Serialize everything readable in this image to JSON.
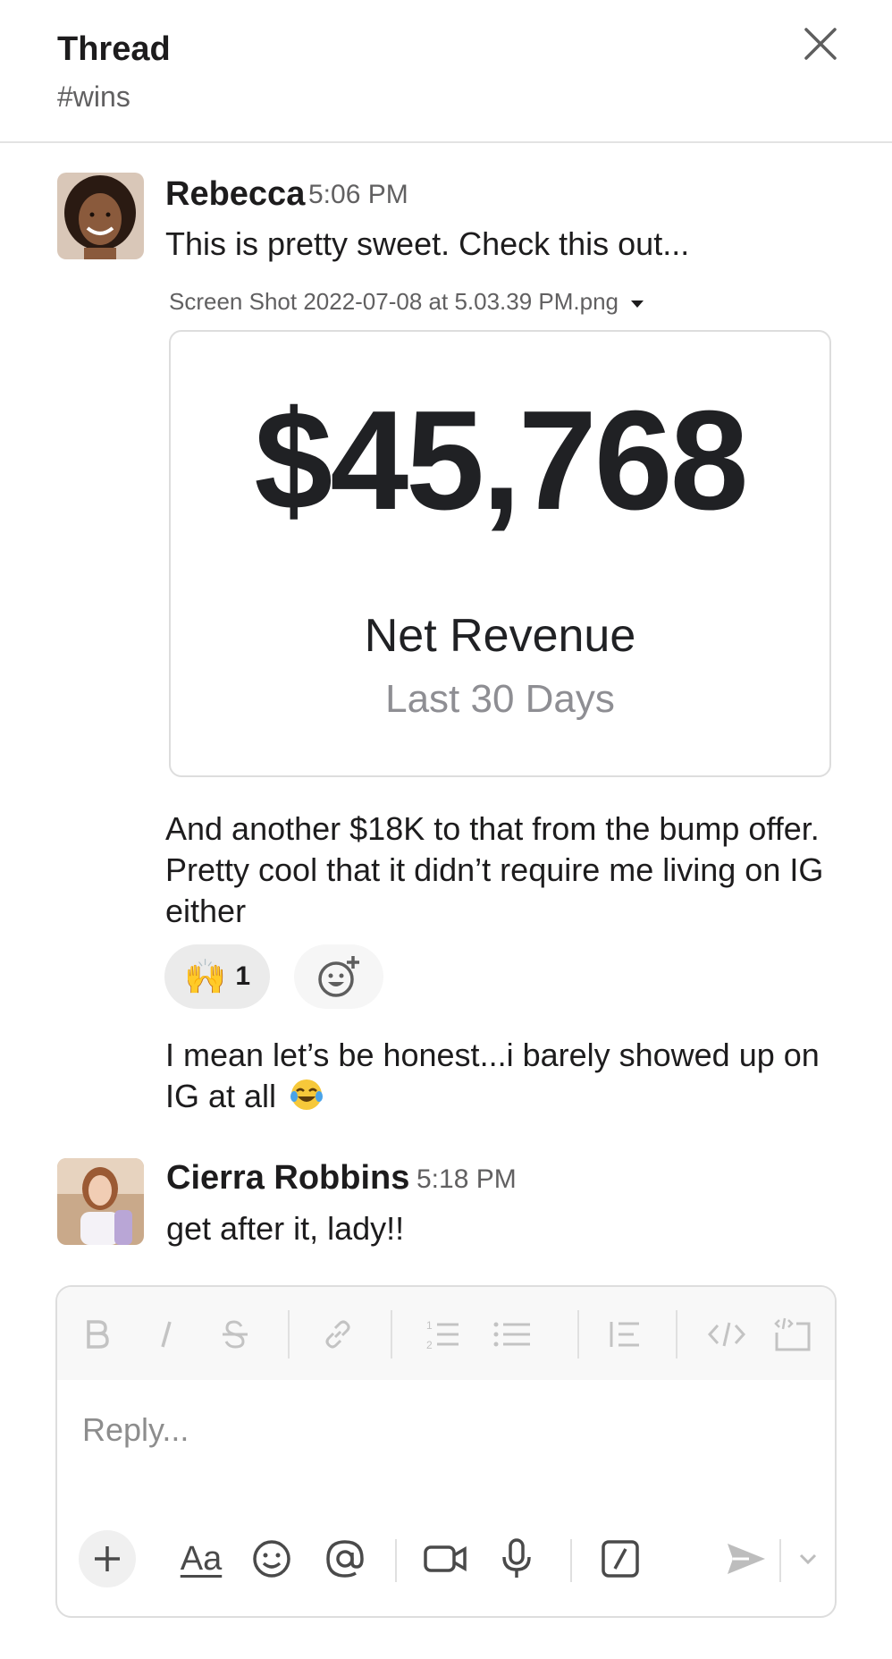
{
  "header": {
    "title": "Thread",
    "channel": "#wins"
  },
  "messages": [
    {
      "author": "Rebecca",
      "time": "5:06 PM",
      "text": "This is pretty sweet. Check this out...",
      "attachment": {
        "file_name": "Screen Shot 2022-07-08 at 5.03.39 PM.png",
        "preview": {
          "amount": "$45,768",
          "label": "Net Revenue",
          "sublabel": "Last 30 Days"
        }
      },
      "followups": [
        "And another $18K to that from the bump offer. Pretty cool that it didn’t require me living on IG either",
        "I mean let’s be honest...i barely showed up on IG at all"
      ],
      "reaction": {
        "emoji": "🙌",
        "count": "1"
      }
    },
    {
      "author": "Cierra Robbins",
      "time": "5:18 PM",
      "text": "get after it, lady!!"
    }
  ],
  "composer": {
    "placeholder": "Reply...",
    "format_label": "Aa",
    "icons": [
      "bold-icon",
      "italic-icon",
      "strikethrough-icon",
      "link-icon",
      "ordered-list-icon",
      "bulleted-list-icon",
      "blockquote-icon",
      "code-icon",
      "code-block-icon",
      "plus-icon",
      "formatting-icon",
      "emoji-icon",
      "mention-icon",
      "video-icon",
      "microphone-icon",
      "slash-command-icon",
      "send-icon",
      "chevron-down-icon"
    ]
  },
  "colors": {
    "text": "#1d1c1d",
    "muted": "#616061",
    "border": "#dddddd",
    "toolbar_bg": "#f8f8f8"
  }
}
